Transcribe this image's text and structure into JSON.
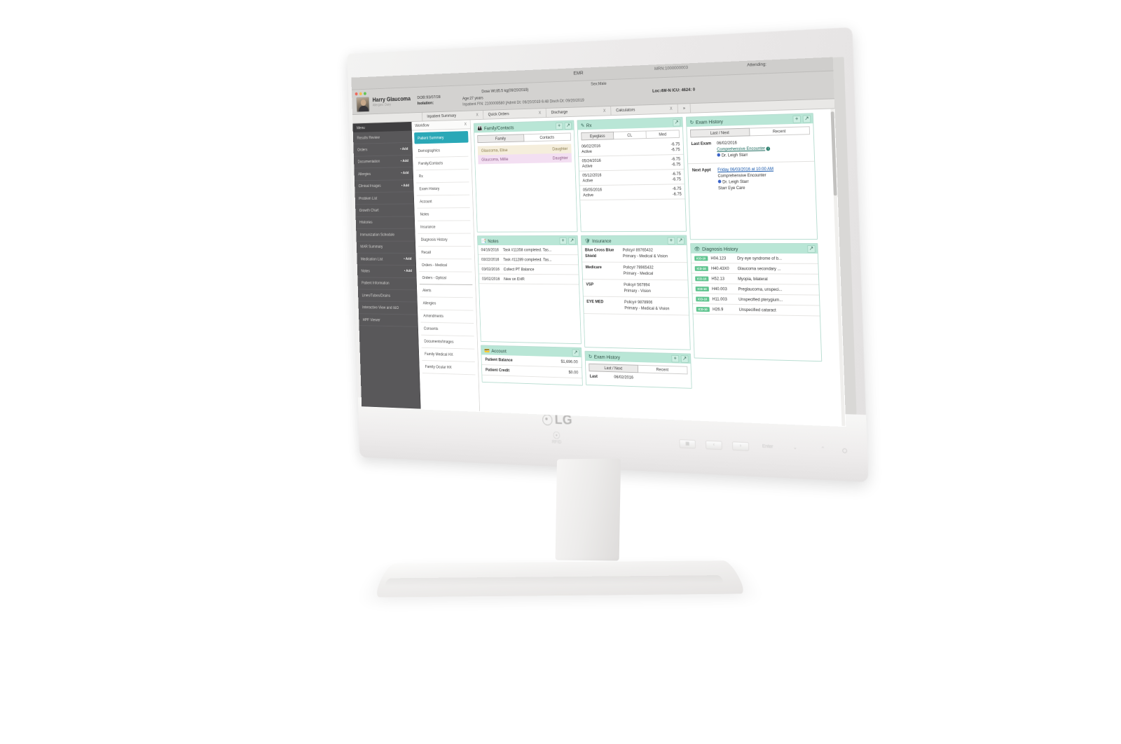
{
  "os_band": {
    "emr_title": "EMR",
    "attending": "Attending:",
    "mrn": "MRN:1000000003"
  },
  "patient": {
    "name": "Harry Glaucoma",
    "allergy_line": "Allergies: Dairy",
    "dob": "DOB:93/07/28",
    "isolation": "Isolation:",
    "age": "Age:27 years",
    "dose_weight": "Dose Wt:85.5 kg(09/20/2019)",
    "sex": "Sex:Male",
    "fin_line": "Inpatient FIN: 2100009580 [Admit Dt: 09/20/2019 6:48 Disch Dt: 09/20/2019",
    "location": "Loc:4W-N ICU: 4624: 0"
  },
  "outer_tabs": [
    {
      "label": "Inpatient Summary",
      "close": "X"
    },
    {
      "label": "Quick Orders",
      "close": "X"
    },
    {
      "label": "Discharge",
      "close": "X"
    },
    {
      "label": "Calculators",
      "close": "X"
    }
  ],
  "outer_tabs_more": "»",
  "sidebar": {
    "header": "Menu",
    "add_label": "• Add",
    "items": [
      {
        "label": "Results Review",
        "add": false
      },
      {
        "label": "Orders",
        "add": true
      },
      {
        "label": "Documentation",
        "add": true
      },
      {
        "label": "Allergies",
        "add": true
      },
      {
        "label": "Clinical Images",
        "add": true
      },
      {
        "label": "Problem List",
        "add": false
      },
      {
        "label": "Growth Chart",
        "add": false
      },
      {
        "label": "Histories",
        "add": false
      },
      {
        "label": "Immunization Schedule",
        "add": false
      },
      {
        "label": "MAR Summary",
        "add": false
      },
      {
        "label": "Medication List",
        "add": true
      },
      {
        "label": "Notes",
        "add": true
      },
      {
        "label": "Patient Information",
        "add": false
      },
      {
        "label": "Lines/Tubes/Drains",
        "add": false
      },
      {
        "label": "Interactive View and I&O",
        "add": false
      },
      {
        "label": "HPF Viewer",
        "add": false
      }
    ]
  },
  "workflow": {
    "header": "Workflow",
    "close": "X",
    "items": [
      "Patient Summary",
      "Demographics",
      "Family/Contacts",
      "Rx",
      "Exam History",
      "Account",
      "Notes",
      "Insurance",
      "Diagnosis History",
      "Recall",
      "Orders - Medical",
      "Orders - Optical",
      "Alerts",
      "Allergies",
      "Amendments",
      "Consents",
      "Documents/Images",
      "Family Medical HX",
      "Family Ocular HX"
    ],
    "active_index": 0
  },
  "widgets": {
    "family_contacts": {
      "title": "Family/Contacts",
      "icon": "people-icon",
      "add": "+",
      "expand": "↗",
      "tabs": [
        "Family",
        "Contacts"
      ],
      "selected_tab": "Family",
      "rows": [
        {
          "name": "Glaucoma, Elise",
          "relation": "Daughter"
        },
        {
          "name": "Glaucoma, Millie",
          "relation": "Daughter"
        }
      ]
    },
    "rx": {
      "title": "Rx",
      "icon": "prescription-icon",
      "add": "+",
      "expand": "↗",
      "tabs": [
        "Eyeglass",
        "CL",
        "Med"
      ],
      "selected_tab": "Eyeglass",
      "rows": [
        {
          "date": "06/02/2016",
          "status": "Active",
          "od": "-6.75",
          "os": "-6.75"
        },
        {
          "date": "05/24/2016",
          "status": "Active",
          "od": "-6.75",
          "os": "-6.75"
        },
        {
          "date": "05/12/2016",
          "status": "Active",
          "od": "-6.75",
          "os": "-6.75"
        },
        {
          "date": "05/05/2016",
          "status": "Active",
          "od": "-6.75",
          "os": "-6.75"
        }
      ]
    },
    "notes": {
      "title": "Notes",
      "icon": "note-icon",
      "add": "+",
      "expand": "↗",
      "rows": [
        {
          "date": "04/16/2016",
          "text": "Task #11358 completed. Tas..."
        },
        {
          "date": "03/22/2016",
          "text": "Task #11289 completed. Tas..."
        },
        {
          "date": "03/02/2016",
          "text": "Collect PT Balance"
        },
        {
          "date": "03/02/2016",
          "text": "New on EHR"
        }
      ]
    },
    "insurance": {
      "title": "Insurance",
      "icon": "shield-icon",
      "add": "+",
      "expand": "↗",
      "rows": [
        {
          "name": "Blue Cross Blue Shield",
          "policy": "Policy# 89765432",
          "type": "Primary - Medical & Vision"
        },
        {
          "name": "Medicare",
          "policy": "Policy# 78965432",
          "type": "Primary - Medical"
        },
        {
          "name": "VSP",
          "policy": "Policy# 567894",
          "type": "Primary - Vision"
        },
        {
          "name": "EYE MED",
          "policy": "Policy# 9878906",
          "type": "Primary - Medical & Vision"
        }
      ]
    },
    "account": {
      "title": "Account",
      "icon": "card-icon",
      "expand": "↗",
      "rows": [
        {
          "label": "Patient Balance",
          "value": "$1,696.00"
        },
        {
          "label": "Patient Credit",
          "value": "$0.00"
        }
      ]
    },
    "exam_history_top": {
      "title": "Exam History",
      "icon": "history-icon",
      "add": "+",
      "expand": "↗",
      "tabs": [
        "Last / Next",
        "Recent"
      ],
      "selected_tab": "Last / Next",
      "last_label": "Last Exam",
      "last_date": "06/02/2016",
      "last_encounter": "Comprehensive Encounter",
      "last_provider": "Dr. Leigh Starr",
      "next_label": "Next Appt",
      "next_date": "Friday 06/03/2016 at 10:00 AM",
      "next_encounter": "Comprehensive Encounter",
      "next_provider": "Dr. Leigh Starr",
      "next_location": "Starr Eye Care"
    },
    "exam_history_bottom": {
      "title": "Exam History",
      "icon": "history-icon",
      "add": "+",
      "expand": "↗",
      "tabs": [
        "Last / Next",
        "Recent"
      ],
      "selected_tab": "Last / Next",
      "last_label": "Last",
      "last_date": "06/02/2016"
    },
    "diagnosis_history": {
      "title": "Diagnosis History",
      "icon": "eye-icon",
      "expand": "↗",
      "badge": "ICD-10",
      "rows": [
        {
          "code": "H04.123",
          "text": "Dry eye syndrome of b..."
        },
        {
          "code": "H40.43X0",
          "text": "Glaucoma secondary ..."
        },
        {
          "code": "H52.13",
          "text": "Myopia, bilateral"
        },
        {
          "code": "H40.003",
          "text": "Preglaucoma, unspeci..."
        },
        {
          "code": "H11.003",
          "text": "Unspecified pterygium..."
        },
        {
          "code": "H26.9",
          "text": "Unspecified cataract"
        }
      ]
    }
  },
  "monitor": {
    "brand": "LG",
    "rfid_label": "RFID",
    "buttons": [
      "⌸",
      "‹",
      "›",
      "Enter",
      "⌄",
      "⌃"
    ]
  },
  "colors": {
    "accent_teal": "#2aa8b7",
    "card_header": "#b9e6d6",
    "icd_badge": "#5fc48f",
    "sidebar_bg": "#59585a",
    "banner_bg": "#d3d2d0"
  }
}
